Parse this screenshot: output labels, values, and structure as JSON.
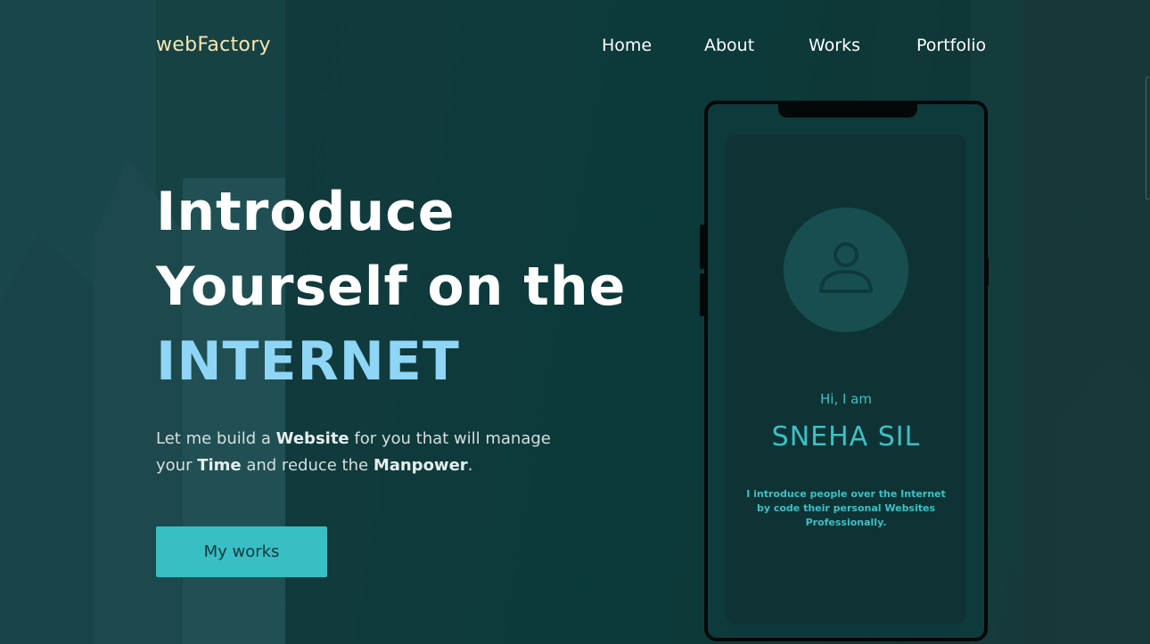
{
  "brand": {
    "logo_text": "webFactory"
  },
  "nav": {
    "items": [
      {
        "label": "Home"
      },
      {
        "label": "About"
      },
      {
        "label": "Works"
      },
      {
        "label": "Portfolio"
      }
    ]
  },
  "hero": {
    "headline_line1": "Introduce",
    "headline_line2": "Yourself on the",
    "headline_accent": "INTERNET",
    "sub_part1": "Let me build a ",
    "sub_bold1": "Website",
    "sub_part2": " for you that will manage your ",
    "sub_bold2": "Time",
    "sub_part3": " and reduce the ",
    "sub_bold3": "Manpower",
    "sub_part4": ".",
    "button_label": "My works"
  },
  "phone_card": {
    "greeting": "Hi, I am",
    "name": "SNEHA SIL",
    "description": "I introduce people over the Internet by code their personal Websites Professionally.",
    "avatar_icon": "user-icon"
  },
  "colors": {
    "accent": "#37bfc4",
    "headline_accent": "#8fd6f6",
    "logo": "#f4e7b2"
  }
}
